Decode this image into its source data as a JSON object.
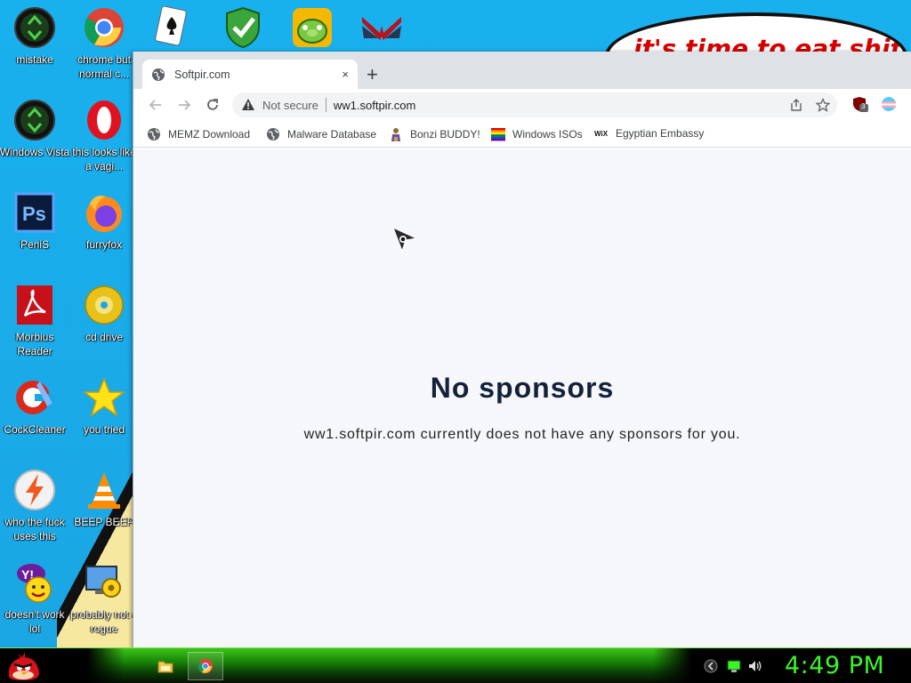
{
  "wallpaper": {
    "bubble_text": "it's time to eat shit"
  },
  "desktop_icons": [
    {
      "label": "mistake",
      "icon": "recycle-bin-icon"
    },
    {
      "label": "chrome but normal c...",
      "icon": "chrome-icon"
    },
    {
      "label": "Windows Vista",
      "icon": "recycle-bin-icon"
    },
    {
      "label": "this looks like a vagi...",
      "icon": "opera-icon"
    },
    {
      "label": "PeniS",
      "icon": "photoshop-icon"
    },
    {
      "label": "furryfox",
      "icon": "firefox-icon"
    },
    {
      "label": "Morbius Reader",
      "icon": "pdf-reader-icon"
    },
    {
      "label": "cd drive",
      "icon": "cd-drive-icon"
    },
    {
      "label": "CockCleaner",
      "icon": "ccleaner-icon"
    },
    {
      "label": "you tried",
      "icon": "star-icon"
    },
    {
      "label": "who the fuck uses this",
      "icon": "flash-icon"
    },
    {
      "label": "BEEP BEEP",
      "icon": "vlc-cone-icon"
    },
    {
      "label": "doesn't work lol",
      "icon": "yahoo-messenger-icon"
    },
    {
      "label": "probably not a rogue",
      "icon": "system-settings-icon"
    },
    {
      "icon": "solitaire-icon"
    },
    {
      "icon": "security-shield-icon"
    },
    {
      "icon": "bad-piggies-icon"
    },
    {
      "icon": "wings-logo-icon"
    }
  ],
  "browser": {
    "tab_title": "Softpir.com",
    "new_tab_label": "+",
    "tab_close_label": "×",
    "security_label": "Not secure",
    "url": "ww1.softpir.com",
    "extension_badge": "3",
    "bookmarks": [
      {
        "label": "MEMZ Download",
        "icon": "globe-icon"
      },
      {
        "label": "Malware Database",
        "icon": "globe-icon"
      },
      {
        "label": "Bonzi BUDDY!",
        "icon": "bonzi-icon"
      },
      {
        "label": "Windows ISOs",
        "icon": "rainbow-flag-icon"
      },
      {
        "label": "Egyptian Embassy",
        "icon": "wix-icon"
      }
    ],
    "bookmark_wix_text": "WiX"
  },
  "page": {
    "heading": "No sponsors",
    "message": "ww1.softpir.com currently does not have any sponsors for you."
  },
  "taskbar": {
    "clock": "4:49 PM"
  },
  "colors": {
    "desktop": "#17a9e6",
    "taskbar_green": "#2db014",
    "clock_green": "#3bf52a",
    "heading": "#15213a"
  }
}
